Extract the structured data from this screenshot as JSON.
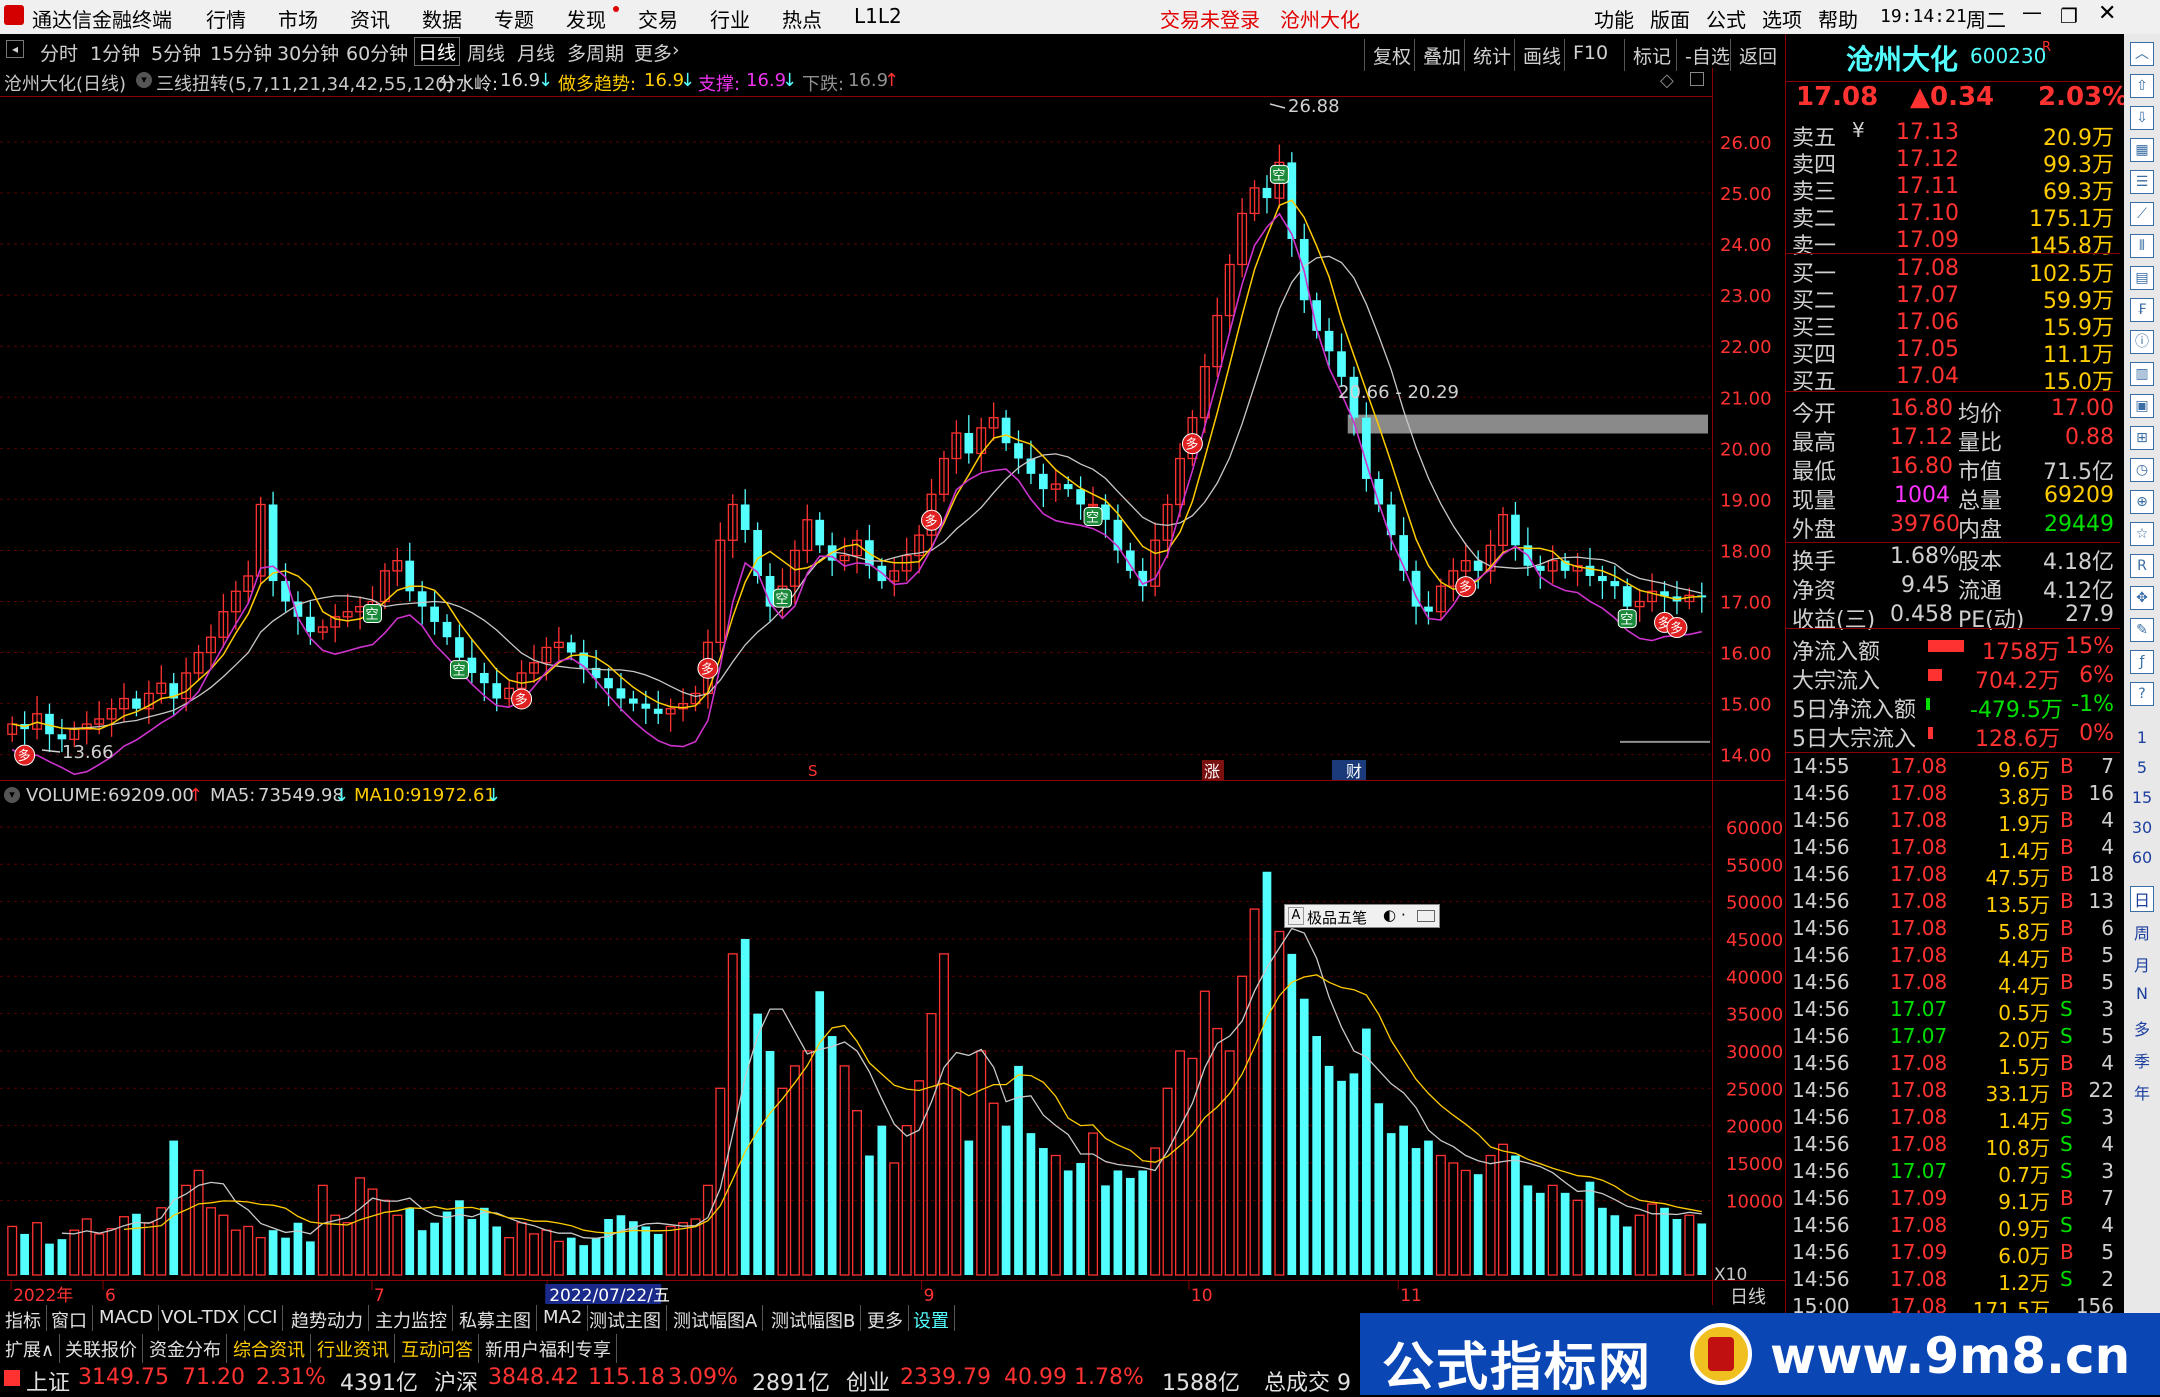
{
  "topbar": {
    "app_title": "通达信金融终端",
    "menus": [
      "行情",
      "市场",
      "资讯",
      "数据",
      "专题",
      "发现",
      "交易",
      "行业",
      "热点",
      "L1L2"
    ],
    "trade_status": "交易未登录",
    "stock_name": "沧州大化",
    "right_menus": [
      "功能",
      "版面",
      "公式",
      "选项",
      "帮助"
    ],
    "time": "19:14:21",
    "weekday": "周二"
  },
  "period_tabs": [
    "分时",
    "1分钟",
    "5分钟",
    "15分钟",
    "30分钟",
    "60分钟",
    "日线",
    "周线",
    "月线",
    "多周期",
    "更多"
  ],
  "period_selected": "日线",
  "tool_buttons": [
    "复权",
    "叠加",
    "统计",
    "画线",
    "F10",
    "标记",
    "-自选",
    "返回"
  ],
  "chart_info": {
    "title": "沧州大化(日线)",
    "indicator": "三线扭转(5,7,11,21,34,42,55,120)",
    "fenshuiling_label": "分水岭:",
    "fenshuiling_value": "16.9",
    "zuoduo_label": "做多趋势:",
    "zuoduo_value": "16.9",
    "zhicheng_label": "支撑:",
    "zhicheng_value": "16.9",
    "xiadie_label": "下跌:",
    "xiadie_value": "16.9"
  },
  "volume_info": {
    "volume_label": "VOLUME:",
    "volume_value": "69209.00",
    "ma5_label": "MA5:",
    "ma5_value": "73549.98",
    "ma10_label": "MA10:",
    "ma10_value": "91972.61"
  },
  "chart_annotations": {
    "high_label": "26.88",
    "low_label": "13.66",
    "zone_label": "20.66 - 20.29",
    "zhang_marker": "涨",
    "caibao_marker": "财",
    "s_marker": "S",
    "plugin_label": "极品五笔",
    "x10_label": "X10",
    "period_label": "日线"
  },
  "signal_labels": {
    "duo": "多",
    "kong": "空"
  },
  "x_axis_labels": [
    "2022年",
    "6",
    "7",
    "2022/07/22/五",
    "9",
    "10",
    "11"
  ],
  "chart_data": [
    {
      "type": "candlestick",
      "title": "沧州大化(日线)",
      "y_ticks": [
        26.0,
        25.0,
        24.0,
        23.0,
        22.0,
        21.0,
        20.0,
        19.0,
        18.0,
        17.0,
        16.0,
        15.0,
        14.0
      ],
      "ylim": [
        13.7,
        26.9
      ],
      "annotations": {
        "high": 26.88,
        "low": 13.66,
        "zone": [
          20.29,
          20.66
        ]
      },
      "series_close": [
        14.6,
        14.5,
        14.8,
        14.4,
        14.3,
        14.5,
        14.6,
        14.7,
        14.9,
        15.1,
        14.9,
        15.2,
        15.4,
        15.1,
        15.6,
        16.0,
        16.3,
        16.8,
        17.2,
        17.5,
        18.9,
        17.4,
        17.0,
        16.7,
        16.4,
        16.5,
        16.7,
        16.8,
        16.9,
        17.0,
        17.6,
        17.8,
        17.2,
        16.9,
        16.6,
        16.3,
        15.9,
        15.6,
        15.4,
        15.1,
        15.3,
        15.6,
        15.8,
        16.1,
        16.2,
        16.0,
        15.7,
        15.5,
        15.3,
        15.1,
        15.0,
        14.9,
        14.8,
        14.9,
        15.0,
        15.2,
        16.2,
        18.2,
        18.9,
        18.4,
        17.5,
        16.9,
        17.3,
        18.0,
        18.6,
        18.1,
        17.8,
        17.9,
        18.2,
        17.7,
        17.4,
        17.6,
        17.9,
        18.3,
        19.1,
        19.8,
        20.3,
        19.9,
        20.4,
        20.6,
        20.1,
        19.8,
        19.5,
        19.2,
        19.3,
        19.2,
        18.9,
        18.9,
        18.6,
        18.0,
        17.6,
        17.3,
        18.2,
        18.9,
        19.8,
        20.6,
        21.6,
        22.6,
        23.6,
        24.6,
        25.1,
        24.9,
        25.6,
        24.1,
        22.9,
        22.3,
        21.9,
        21.4,
        20.6,
        19.4,
        18.9,
        18.3,
        17.6,
        16.9,
        16.8,
        17.3,
        17.6,
        17.8,
        17.6,
        18.1,
        18.7,
        18.1,
        17.7,
        17.6,
        17.8,
        17.6,
        17.7,
        17.5,
        17.4,
        17.3,
        16.9,
        17.0,
        17.2,
        17.1,
        17.0,
        17.12,
        17.08
      ]
    },
    {
      "type": "bar",
      "title": "VOLUME",
      "y_ticks": [
        60000,
        55000,
        50000,
        45000,
        40000,
        35000,
        30000,
        25000,
        20000,
        15000,
        10000
      ],
      "ylim": [
        0,
        62000
      ],
      "values": [
        6500,
        5500,
        7000,
        4200,
        4800,
        6000,
        7500,
        5500,
        6200,
        7800,
        8200,
        7000,
        9000,
        18000,
        12000,
        14000,
        9000,
        8000,
        6000,
        6500,
        5000,
        6000,
        5000,
        7000,
        4500,
        12000,
        8000,
        7000,
        13000,
        11500,
        10000,
        8000,
        9000,
        6000,
        7000,
        8500,
        10000,
        7500,
        9000,
        6500,
        5000,
        7000,
        5500,
        6000,
        4500,
        5000,
        4000,
        5000,
        7500,
        8000,
        7200,
        6500,
        5500,
        6500,
        7000,
        7500,
        12000,
        25000,
        43000,
        45000,
        35000,
        30000,
        25000,
        28000,
        30000,
        38000,
        32000,
        28000,
        22000,
        16000,
        20000,
        15000,
        20000,
        26000,
        35000,
        43000,
        25000,
        18000,
        30000,
        23000,
        20000,
        28000,
        19000,
        17000,
        16000,
        14000,
        15000,
        19000,
        12000,
        14000,
        13000,
        14000,
        17000,
        25000,
        30000,
        29000,
        38000,
        33000,
        30000,
        40000,
        49000,
        54000,
        46000,
        43000,
        37000,
        32000,
        28000,
        26000,
        27000,
        33000,
        23000,
        19000,
        20000,
        17000,
        18000,
        16000,
        15000,
        14000,
        13500,
        16000,
        17500,
        16000,
        12000,
        11000,
        12000,
        11000,
        10000,
        12500,
        9000,
        8000,
        6500,
        8000,
        9500,
        9000,
        7500,
        8000,
        6900
      ]
    }
  ],
  "quote": {
    "name": "沧州大化",
    "code": "600230",
    "code_suffix": "R",
    "price": "17.08",
    "change": "▲0.34",
    "change_pct": "2.03%",
    "sells": [
      {
        "label": "卖五",
        "price": "17.13",
        "vol": "20.9万"
      },
      {
        "label": "卖四",
        "price": "17.12",
        "vol": "99.3万"
      },
      {
        "label": "卖三",
        "price": "17.11",
        "vol": "69.3万"
      },
      {
        "label": "卖二",
        "price": "17.10",
        "vol": "175.1万"
      },
      {
        "label": "卖一",
        "price": "17.09",
        "vol": "145.8万"
      }
    ],
    "sell5_suffix": "¥",
    "buys": [
      {
        "label": "买一",
        "price": "17.08",
        "vol": "102.5万"
      },
      {
        "label": "买二",
        "price": "17.07",
        "vol": "59.9万"
      },
      {
        "label": "买三",
        "price": "17.06",
        "vol": "15.9万"
      },
      {
        "label": "买四",
        "price": "17.05",
        "vol": "11.1万"
      },
      {
        "label": "买五",
        "price": "17.04",
        "vol": "15.0万"
      }
    ],
    "stats": [
      {
        "l1": "今开",
        "v1": "16.80",
        "l2": "均价",
        "v2": "17.00"
      },
      {
        "l1": "最高",
        "v1": "17.12",
        "l2": "量比",
        "v2": "0.88"
      },
      {
        "l1": "最低",
        "v1": "16.80",
        "l2": "市值",
        "v2": "71.5亿"
      },
      {
        "l1": "现量",
        "v1": "1004",
        "l2": "总量",
        "v2": "69209"
      },
      {
        "l1": "外盘",
        "v1": "39760",
        "l2": "内盘",
        "v2": "29449"
      }
    ],
    "fin": [
      {
        "l1": "换手",
        "v1": "1.68%",
        "l2": "股本",
        "v2": "4.18亿"
      },
      {
        "l1": "净资",
        "v1": "9.45",
        "l2": "流通",
        "v2": "4.12亿"
      },
      {
        "l1": "收益(三)",
        "v1": "0.458",
        "l2": "PE(动)",
        "v2": "27.9"
      }
    ],
    "flows": [
      {
        "label": "净流入额",
        "value": "1758万",
        "pct": "15%",
        "bar": 1
      },
      {
        "label": "大宗流入",
        "value": "704.2万",
        "pct": "6%",
        "bar": 0.4
      },
      {
        "label": "5日净流入额",
        "value": "-479.5万",
        "pct": "-1%",
        "bar": -0.1
      },
      {
        "label": "5日大宗流入",
        "value": "128.6万",
        "pct": "0%",
        "bar": 0.15
      }
    ]
  },
  "ticks": [
    {
      "t": "14:55",
      "p": "17.08",
      "v": "9.6万",
      "s": "B",
      "n": "7"
    },
    {
      "t": "14:56",
      "p": "17.08",
      "v": "3.8万",
      "s": "B",
      "n": "16"
    },
    {
      "t": "14:56",
      "p": "17.08",
      "v": "1.9万",
      "s": "B",
      "n": "4"
    },
    {
      "t": "14:56",
      "p": "17.08",
      "v": "1.4万",
      "s": "B",
      "n": "4"
    },
    {
      "t": "14:56",
      "p": "17.08",
      "v": "47.5万",
      "s": "B",
      "n": "18"
    },
    {
      "t": "14:56",
      "p": "17.08",
      "v": "13.5万",
      "s": "B",
      "n": "13"
    },
    {
      "t": "14:56",
      "p": "17.08",
      "v": "5.8万",
      "s": "B",
      "n": "6"
    },
    {
      "t": "14:56",
      "p": "17.08",
      "v": "4.4万",
      "s": "B",
      "n": "5"
    },
    {
      "t": "14:56",
      "p": "17.08",
      "v": "4.4万",
      "s": "B",
      "n": "5"
    },
    {
      "t": "14:56",
      "p": "17.07",
      "v": "0.5万",
      "s": "S",
      "n": "3"
    },
    {
      "t": "14:56",
      "p": "17.07",
      "v": "2.0万",
      "s": "S",
      "n": "5"
    },
    {
      "t": "14:56",
      "p": "17.08",
      "v": "1.5万",
      "s": "B",
      "n": "4"
    },
    {
      "t": "14:56",
      "p": "17.08",
      "v": "33.1万",
      "s": "B",
      "n": "22"
    },
    {
      "t": "14:56",
      "p": "17.08",
      "v": "1.4万",
      "s": "S",
      "n": "3"
    },
    {
      "t": "14:56",
      "p": "17.08",
      "v": "10.8万",
      "s": "S",
      "n": "4"
    },
    {
      "t": "14:56",
      "p": "17.07",
      "v": "0.7万",
      "s": "S",
      "n": "3"
    },
    {
      "t": "14:56",
      "p": "17.09",
      "v": "9.1万",
      "s": "B",
      "n": "7"
    },
    {
      "t": "14:56",
      "p": "17.08",
      "v": "0.9万",
      "s": "S",
      "n": "4"
    },
    {
      "t": "14:56",
      "p": "17.09",
      "v": "6.0万",
      "s": "B",
      "n": "5"
    },
    {
      "t": "14:56",
      "p": "17.08",
      "v": "1.2万",
      "s": "S",
      "n": "2"
    },
    {
      "t": "15:00",
      "p": "17.08",
      "v": "171.5万",
      "s": "",
      "n": "156"
    }
  ],
  "sidebar_labels": [
    "日",
    "周",
    "月",
    "N",
    "多",
    "季",
    "年"
  ],
  "sidebar_numbers": [
    "1",
    "5",
    "15",
    "30",
    "60"
  ],
  "bottom_tabs": [
    "指标",
    "窗口",
    "MACD",
    "VOL-TDX",
    "CCI",
    "趋势动力",
    "主力监控",
    "私募主图",
    "MA2",
    "测试主图",
    "测试幅图A",
    "测试幅图B",
    "更多",
    "设置"
  ],
  "bottom_tabs2": [
    "扩展∧",
    "关联报价",
    "资金分布",
    "综合资讯",
    "行业资讯",
    "互动问答",
    "新用户福利专享"
  ],
  "status": [
    {
      "name": "上证",
      "val": "3149.75",
      "chg": "71.20",
      "pct": "2.31%",
      "amt": "4391亿"
    },
    {
      "name": "沪深",
      "val": "3848.42",
      "chg": "115.18",
      "pct": "3.09%",
      "amt": "2891亿"
    },
    {
      "name": "创业",
      "val": "2339.79",
      "chg": "40.99",
      "pct": "1.78%",
      "amt": "1588亿"
    }
  ],
  "status_tail": "总成交 9",
  "banner": {
    "title": "公式指标网",
    "url": "www.9m8.cn"
  },
  "colors": {
    "up": "#ff3232",
    "down": "#54ffff",
    "ma_white": "#c8c8c8",
    "ma_yellow": "#ffcc00",
    "ma_magenta": "#cc33cc"
  }
}
